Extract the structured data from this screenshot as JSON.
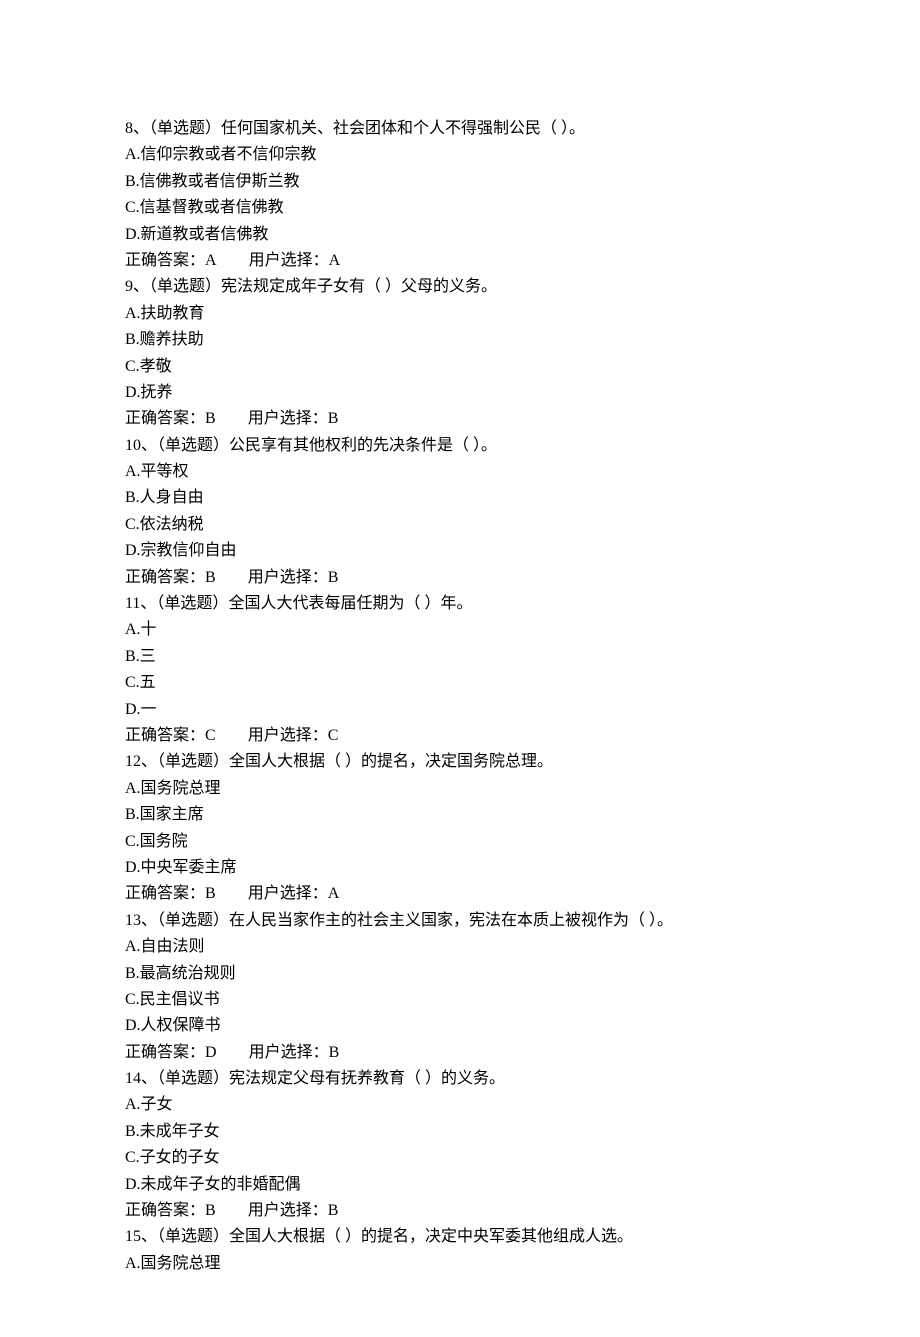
{
  "questions": [
    {
      "number": "8",
      "type": "（单选题）",
      "stem": "任何国家机关、社会团体和个人不得强制公民（  ）。",
      "options": [
        "A.信仰宗教或者不信仰宗教",
        "B.信佛教或者信伊斯兰教",
        "C.信基督教或者信佛教",
        "D.新道教或者信佛教"
      ],
      "correct": "正确答案：A",
      "user": "用户选择：A"
    },
    {
      "number": "9",
      "type": "（单选题）",
      "stem": "宪法规定成年子女有（  ）父母的义务。",
      "options": [
        "A.扶助教育",
        "B.赡养扶助",
        "C.孝敬",
        "D.抚养"
      ],
      "correct": "正确答案：B",
      "user": "用户选择：B"
    },
    {
      "number": "10",
      "type": "（单选题）",
      "stem": "公民享有其他权利的先决条件是（  ）。",
      "options": [
        "A.平等权",
        "B.人身自由",
        "C.依法纳税",
        "D.宗教信仰自由"
      ],
      "correct": "正确答案：B",
      "user": "用户选择：B"
    },
    {
      "number": "11",
      "type": "（单选题）",
      "stem": "全国人大代表每届任期为（  ）年。",
      "options": [
        "A.十",
        "B.三",
        "C.五",
        "D.一"
      ],
      "correct": "正确答案：C",
      "user": "用户选择：C"
    },
    {
      "number": "12",
      "type": "（单选题）",
      "stem": "全国人大根据（  ）的提名，决定国务院总理。",
      "options": [
        "A.国务院总理",
        "B.国家主席",
        "C.国务院",
        "D.中央军委主席"
      ],
      "correct": "正确答案：B",
      "user": "用户选择：A"
    },
    {
      "number": "13",
      "type": "（单选题）",
      "stem": "在人民当家作主的社会主义国家，宪法在本质上被视作为（  ）。",
      "options": [
        "A.自由法则",
        "B.最高统治规则",
        "C.民主倡议书",
        "D.人权保障书"
      ],
      "correct": "正确答案：D",
      "user": "用户选择：B"
    },
    {
      "number": "14",
      "type": "（单选题）",
      "stem": "宪法规定父母有抚养教育（  ）的义务。",
      "options": [
        "A.子女",
        "B.未成年子女",
        "C.子女的子女",
        "D.未成年子女的非婚配偶"
      ],
      "correct": "正确答案：B",
      "user": "用户选择：B"
    },
    {
      "number": "15",
      "type": "（单选题）",
      "stem": "全国人大根据（  ）的提名，决定中央军委其他组成人选。",
      "options": [
        "A.国务院总理"
      ],
      "correct": null,
      "user": null
    }
  ]
}
